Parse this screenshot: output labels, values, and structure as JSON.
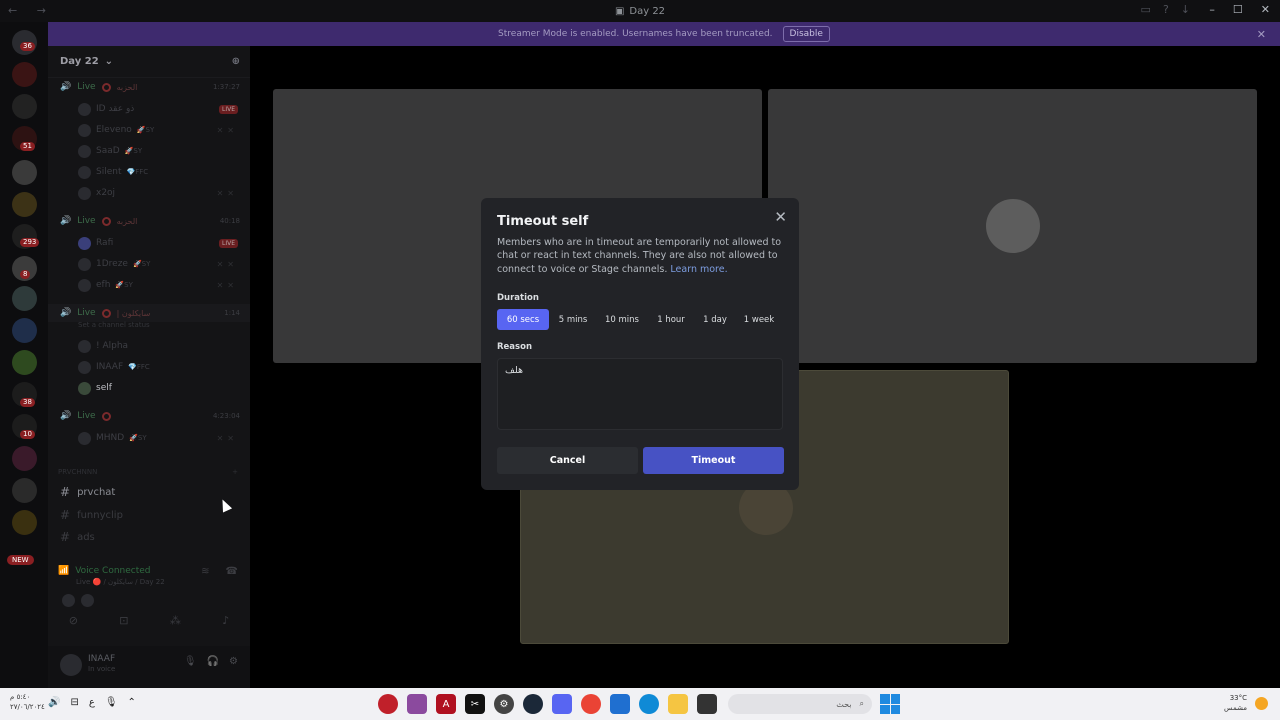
{
  "window": {
    "title": "Day 22",
    "nav": "← →",
    "controls": [
      "–",
      "☐",
      "✕"
    ]
  },
  "banner": {
    "text": "Streamer Mode is enabled. Usernames have been truncated.",
    "disable_label": "Disable"
  },
  "guild_badges": [
    "36",
    "51",
    "293",
    "8",
    "38",
    "10"
  ],
  "guild_new_label": "NEW",
  "server": {
    "name": "Day 22"
  },
  "voice_channels": [
    {
      "name": "Live",
      "suffix": "الحزبه",
      "time": "1:37:27",
      "users": [
        {
          "name": "ID ذو عقد",
          "tag": "",
          "live": "LIVE"
        },
        {
          "name": "Eleveno",
          "tag": "🚀SY",
          "live": ""
        },
        {
          "name": "SaaD",
          "tag": "🚀SY",
          "live": ""
        },
        {
          "name": "Silent",
          "tag": "💎FFC",
          "live": ""
        },
        {
          "name": "x2oj",
          "tag": "",
          "live": ""
        }
      ]
    },
    {
      "name": "Live",
      "suffix": "الحزبه",
      "time": "40:18",
      "users": [
        {
          "name": "Rafi",
          "tag": "",
          "live": "LIVE"
        },
        {
          "name": "1Dreze",
          "tag": "🚀SY",
          "live": ""
        },
        {
          "name": "efh",
          "tag": "🚀SY",
          "live": ""
        }
      ]
    },
    {
      "name": "Live",
      "suffix": "| سايكلون",
      "time": "1:14",
      "status": "Set a channel status",
      "users": [
        {
          "name": "! Alpha",
          "tag": "",
          "live": ""
        },
        {
          "name": "INAAF",
          "tag": "💎FFC",
          "live": ""
        },
        {
          "name": "self",
          "tag": "",
          "live": ""
        }
      ]
    },
    {
      "name": "Live",
      "suffix": "",
      "time": "4:23:04",
      "users": [
        {
          "name": "MHND",
          "tag": "🚀SY",
          "live": ""
        }
      ]
    }
  ],
  "category": "PRVCHNNN",
  "text_channels": [
    {
      "name": "prvchat"
    },
    {
      "name": "funnyclip"
    },
    {
      "name": "ads"
    }
  ],
  "voice_connected": {
    "title": "Voice Connected",
    "subtitle": "Live 🔴 / سايكلون / Day 22"
  },
  "user_panel": {
    "name": "INAAF",
    "status": "In voice"
  },
  "modal": {
    "title": "Timeout self",
    "description": "Members who are in timeout are temporarily not allowed to chat or react in text channels. They are also not allowed to connect to voice or Stage channels.",
    "learn_more": "Learn more.",
    "duration_label": "Duration",
    "durations": [
      "60 secs",
      "5 mins",
      "10 mins",
      "1 hour",
      "1 day",
      "1 week"
    ],
    "selected_duration": "60 secs",
    "reason_label": "Reason",
    "reason_value": "هلف",
    "cancel_label": "Cancel",
    "confirm_label": "Timeout"
  },
  "taskbar": {
    "time": "٥:٤٠ م",
    "date": "٢٧/٠٦/٢٠٢٤",
    "search_placeholder": "بحث",
    "weather_temp": "33°C",
    "weather_desc": "مشمس"
  }
}
